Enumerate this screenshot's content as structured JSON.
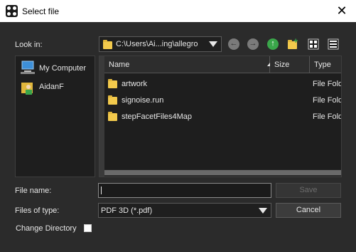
{
  "window": {
    "title": "Select file",
    "close_glyph": "✕"
  },
  "look_in": {
    "label": "Look in:",
    "value": "C:\\Users\\Ai...ing\\allegro"
  },
  "toolbar": [
    "back-icon",
    "forward-icon",
    "up-folder-icon",
    "new-folder-icon",
    "list-view-icon",
    "detail-view-icon"
  ],
  "places": [
    {
      "label": "My Computer",
      "icon": "computer-icon"
    },
    {
      "label": "AidanF",
      "icon": "user-folder-icon"
    }
  ],
  "file_list": {
    "columns": {
      "name": "Name",
      "size": "Size",
      "type": "Type"
    },
    "rows": [
      {
        "name": "artwork",
        "type": "File Folder"
      },
      {
        "name": "signoise.run",
        "type": "File Folder"
      },
      {
        "name": "stepFacetFiles4Map",
        "type": "File Folder"
      }
    ]
  },
  "file_name": {
    "label": "File name:",
    "value": ""
  },
  "file_type": {
    "label": "Files of type:",
    "value": "PDF 3D (*.pdf)"
  },
  "buttons": {
    "save": "Save",
    "cancel": "Cancel"
  },
  "change_directory": {
    "label": "Change Directory",
    "checked": false
  },
  "colors": {
    "background": "#2b2b2b",
    "panel": "#1e1e1e",
    "folder": "#f2c94c",
    "up_arrow": "#3aa64a"
  }
}
